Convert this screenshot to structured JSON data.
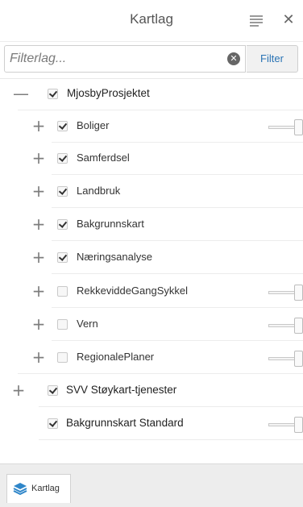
{
  "header": {
    "title": "Kartlag"
  },
  "search": {
    "placeholder": "Filterlag...",
    "value": "",
    "filter_label": "Filter"
  },
  "layers": [
    {
      "label": "MjosbyProsjektet",
      "expander": "—",
      "checked": true,
      "slider": false
    },
    {
      "label": "Boliger",
      "expander": "+",
      "checked": true,
      "slider": true
    },
    {
      "label": "Samferdsel",
      "expander": "+",
      "checked": true,
      "slider": false
    },
    {
      "label": "Landbruk",
      "expander": "+",
      "checked": true,
      "slider": false
    },
    {
      "label": "Bakgrunnskart",
      "expander": "+",
      "checked": true,
      "slider": false
    },
    {
      "label": "Næringsanalyse",
      "expander": "+",
      "checked": true,
      "slider": false
    },
    {
      "label": "RekkeviddeGangSykkel",
      "expander": "+",
      "checked": false,
      "slider": true
    },
    {
      "label": "Vern",
      "expander": "+",
      "checked": false,
      "slider": true
    },
    {
      "label": "RegionalePlaner",
      "expander": "+",
      "checked": false,
      "slider": true
    },
    {
      "label": "SVV Støykart-tjenester",
      "expander": "+",
      "checked": true,
      "slider": false
    },
    {
      "label": "Bakgrunnskart Standard",
      "expander": "",
      "checked": true,
      "slider": true
    }
  ],
  "tabbar": {
    "tab_label": "Kartlag",
    "icon": "layers-icon"
  },
  "colors": {
    "accent": "#2a74b5",
    "layers_icon": "#2f86c9"
  }
}
